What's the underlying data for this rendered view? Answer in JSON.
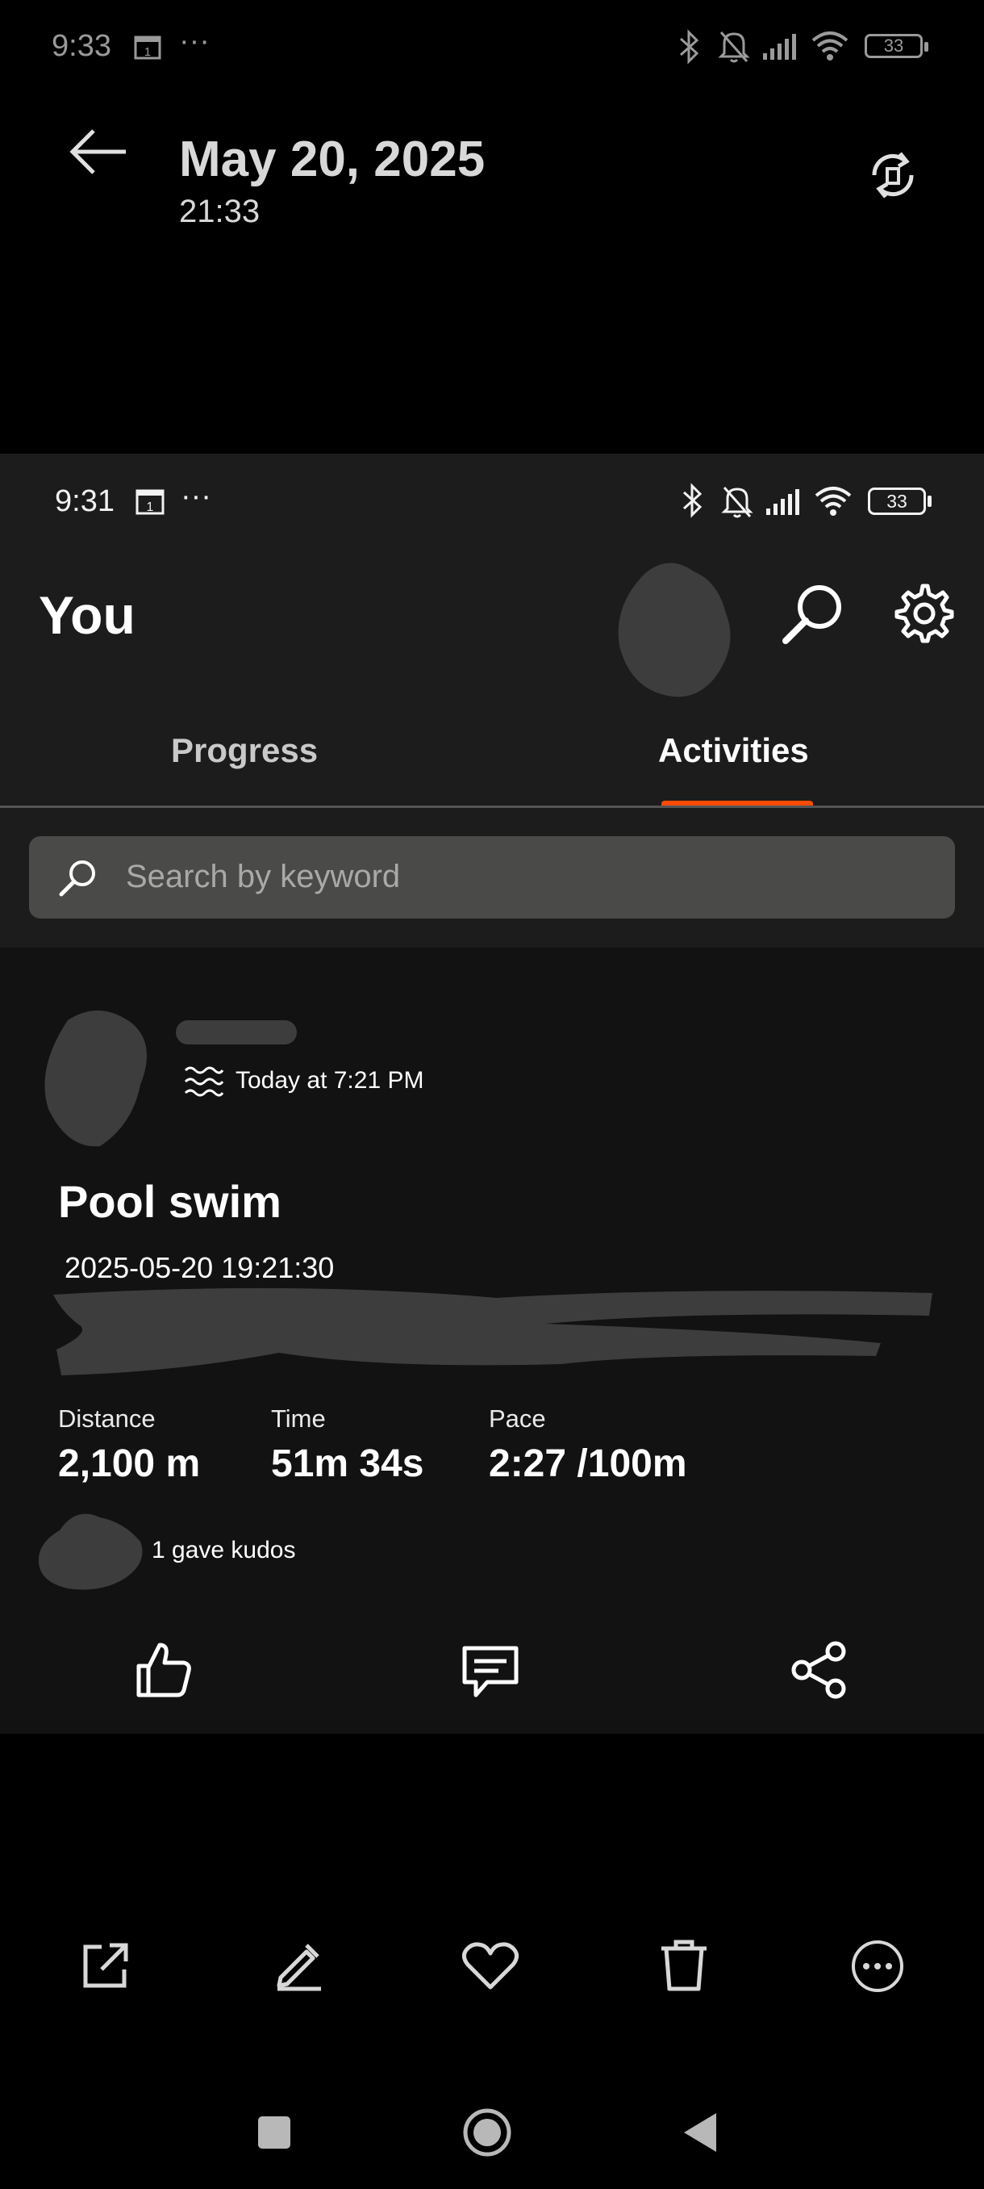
{
  "status_top": {
    "time": "9:33",
    "more": "···",
    "battery": "33"
  },
  "viewer": {
    "date": "May 20, 2025",
    "time": "21:33"
  },
  "status_inner": {
    "time": "9:31",
    "more": "···",
    "battery": "33"
  },
  "header": {
    "title": "You"
  },
  "tabs": [
    {
      "label": "Progress",
      "active": false
    },
    {
      "label": "Activities",
      "active": true
    }
  ],
  "search": {
    "placeholder": "Search by keyword"
  },
  "activity": {
    "meta": "Today at 7:21 PM",
    "title": "Pool swim",
    "timestamp": "2025-05-20 19:21:30",
    "stats": [
      {
        "label": "Distance",
        "value": "2,100 m"
      },
      {
        "label": "Time",
        "value": "51m 34s"
      },
      {
        "label": "Pace",
        "value": "2:27 /100m"
      }
    ],
    "kudos": "1 gave kudos"
  },
  "colors": {
    "accent": "#fc4c02",
    "card": "#121212",
    "surface": "#1c1c1c"
  }
}
